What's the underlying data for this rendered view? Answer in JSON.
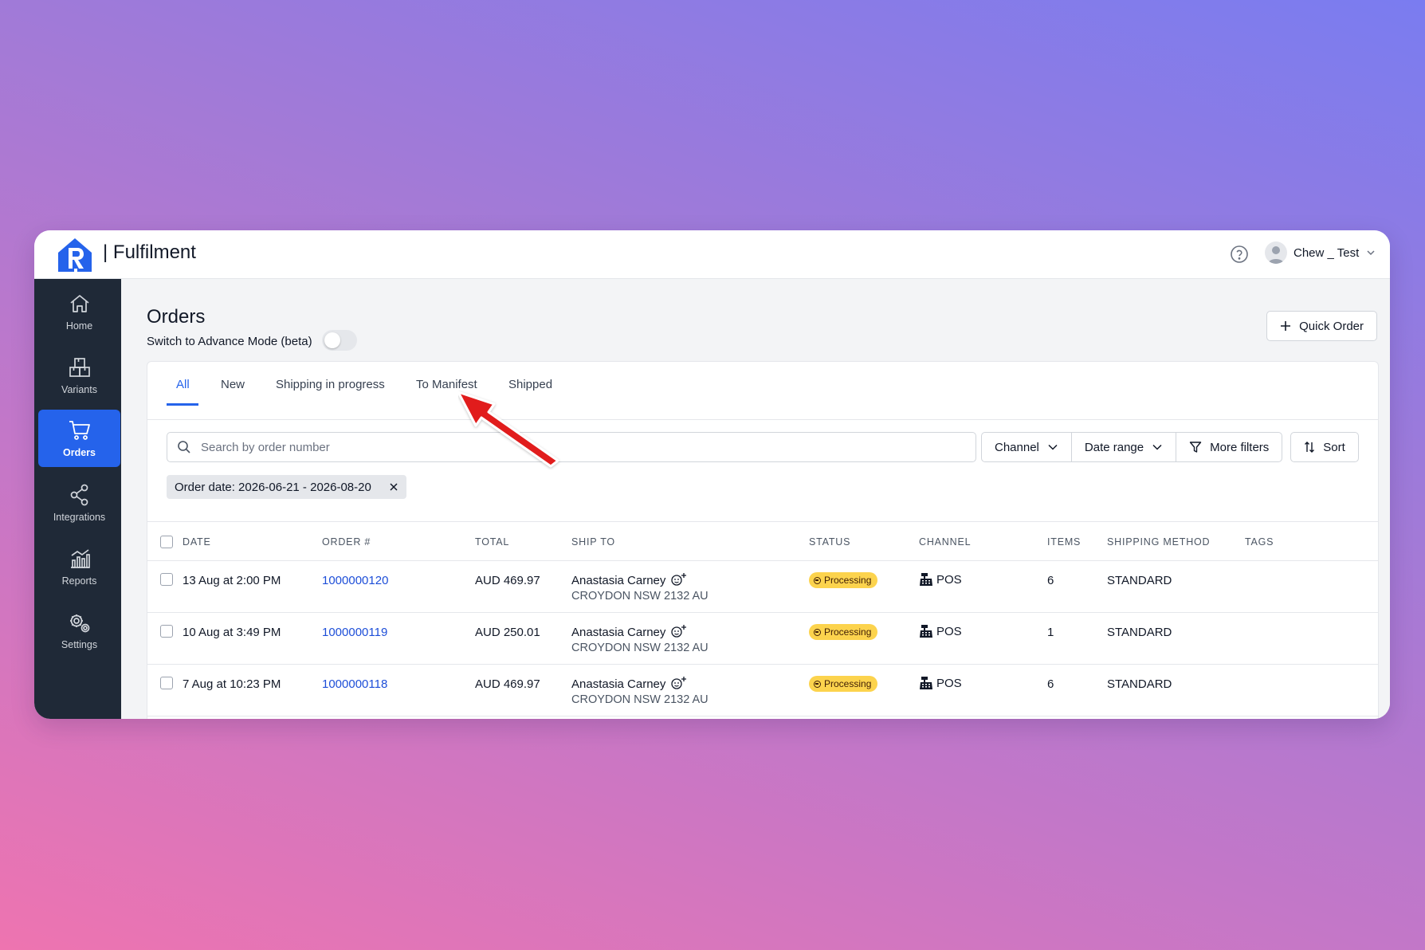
{
  "app": {
    "title": "| Fulfilment",
    "user_name": "Chew _ Test"
  },
  "sidebar": {
    "items": [
      {
        "label": "Home",
        "icon": "home-icon"
      },
      {
        "label": "Variants",
        "icon": "boxes-icon"
      },
      {
        "label": "Orders",
        "icon": "cart-icon",
        "active": true
      },
      {
        "label": "Integrations",
        "icon": "share-icon"
      },
      {
        "label": "Reports",
        "icon": "chart-icon"
      },
      {
        "label": "Settings",
        "icon": "gear-icon"
      }
    ]
  },
  "page": {
    "title": "Orders",
    "advance_mode_label": "Switch to Advance Mode (beta)",
    "quick_order_label": "Quick Order"
  },
  "tabs": [
    {
      "label": "All",
      "active": true
    },
    {
      "label": "New"
    },
    {
      "label": "Shipping in progress"
    },
    {
      "label": "To Manifest"
    },
    {
      "label": "Shipped"
    }
  ],
  "search": {
    "placeholder": "Search by order number"
  },
  "filters": {
    "channel": "Channel",
    "date_range": "Date range",
    "more_filters": "More filters",
    "sort": "Sort"
  },
  "active_filter_chip": "Order date: 2026-06-21 - 2026-08-20",
  "table": {
    "columns": [
      "DATE",
      "ORDER #",
      "TOTAL",
      "SHIP TO",
      "STATUS",
      "CHANNEL",
      "ITEMS",
      "SHIPPING METHOD",
      "TAGS"
    ],
    "rows": [
      {
        "date": "13 Aug at 2:00 PM",
        "order": "1000000120",
        "total": "AUD 469.97",
        "name": "Anastasia Carney",
        "address": "CROYDON NSW 2132 AU",
        "status": "Processing",
        "channel": "POS",
        "items": "6",
        "shipping": "STANDARD",
        "tags": ""
      },
      {
        "date": "10 Aug at 3:49 PM",
        "order": "1000000119",
        "total": "AUD 250.01",
        "name": "Anastasia Carney",
        "address": "CROYDON NSW 2132 AU",
        "status": "Processing",
        "channel": "POS",
        "items": "1",
        "shipping": "STANDARD",
        "tags": ""
      },
      {
        "date": "7 Aug at 10:23 PM",
        "order": "1000000118",
        "total": "AUD 469.97",
        "name": "Anastasia Carney",
        "address": "CROYDON NSW 2132 AU",
        "status": "Processing",
        "channel": "POS",
        "items": "6",
        "shipping": "STANDARD",
        "tags": ""
      }
    ]
  },
  "colors": {
    "accent": "#2563eb",
    "sidebar_bg": "#1f2937",
    "badge": "#fcd34d",
    "annotation_arrow": "#e11d1d"
  }
}
